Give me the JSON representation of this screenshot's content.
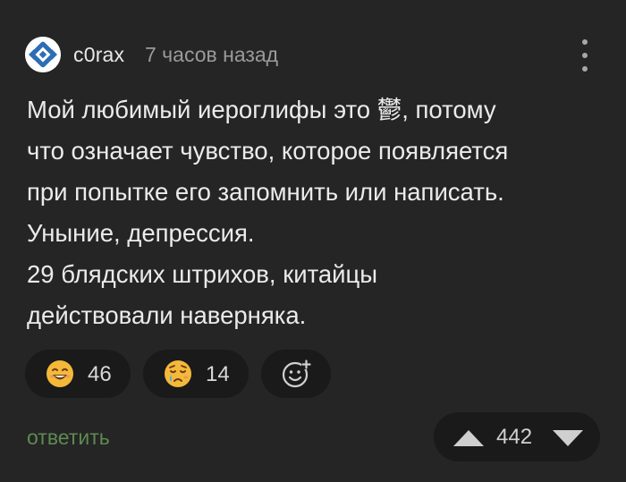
{
  "comment": {
    "author": "c0rax",
    "time": "7 часов назад",
    "text_lines": [
      "Мой любимый иероглифы это 鬱, потому",
      "что означает чувство, которое появляется",
      "при попытке его запомнить или написать.",
      "Уныние, депрессия.",
      "29 блядских штрихов, китайцы",
      "действовали наверняка."
    ]
  },
  "reactions": [
    {
      "icon": "smiling-face-emoji-icon",
      "count": "46"
    },
    {
      "icon": "crying-face-emoji-icon",
      "count": "14"
    },
    {
      "icon": "add-reaction-icon"
    }
  ],
  "actions": {
    "reply_label": "ответить"
  },
  "rating": {
    "score": "442"
  },
  "colors": {
    "background": "#252525",
    "reply": "#5e8a52",
    "pill": "#1a1a1a",
    "emoji": "#f4b93a"
  }
}
